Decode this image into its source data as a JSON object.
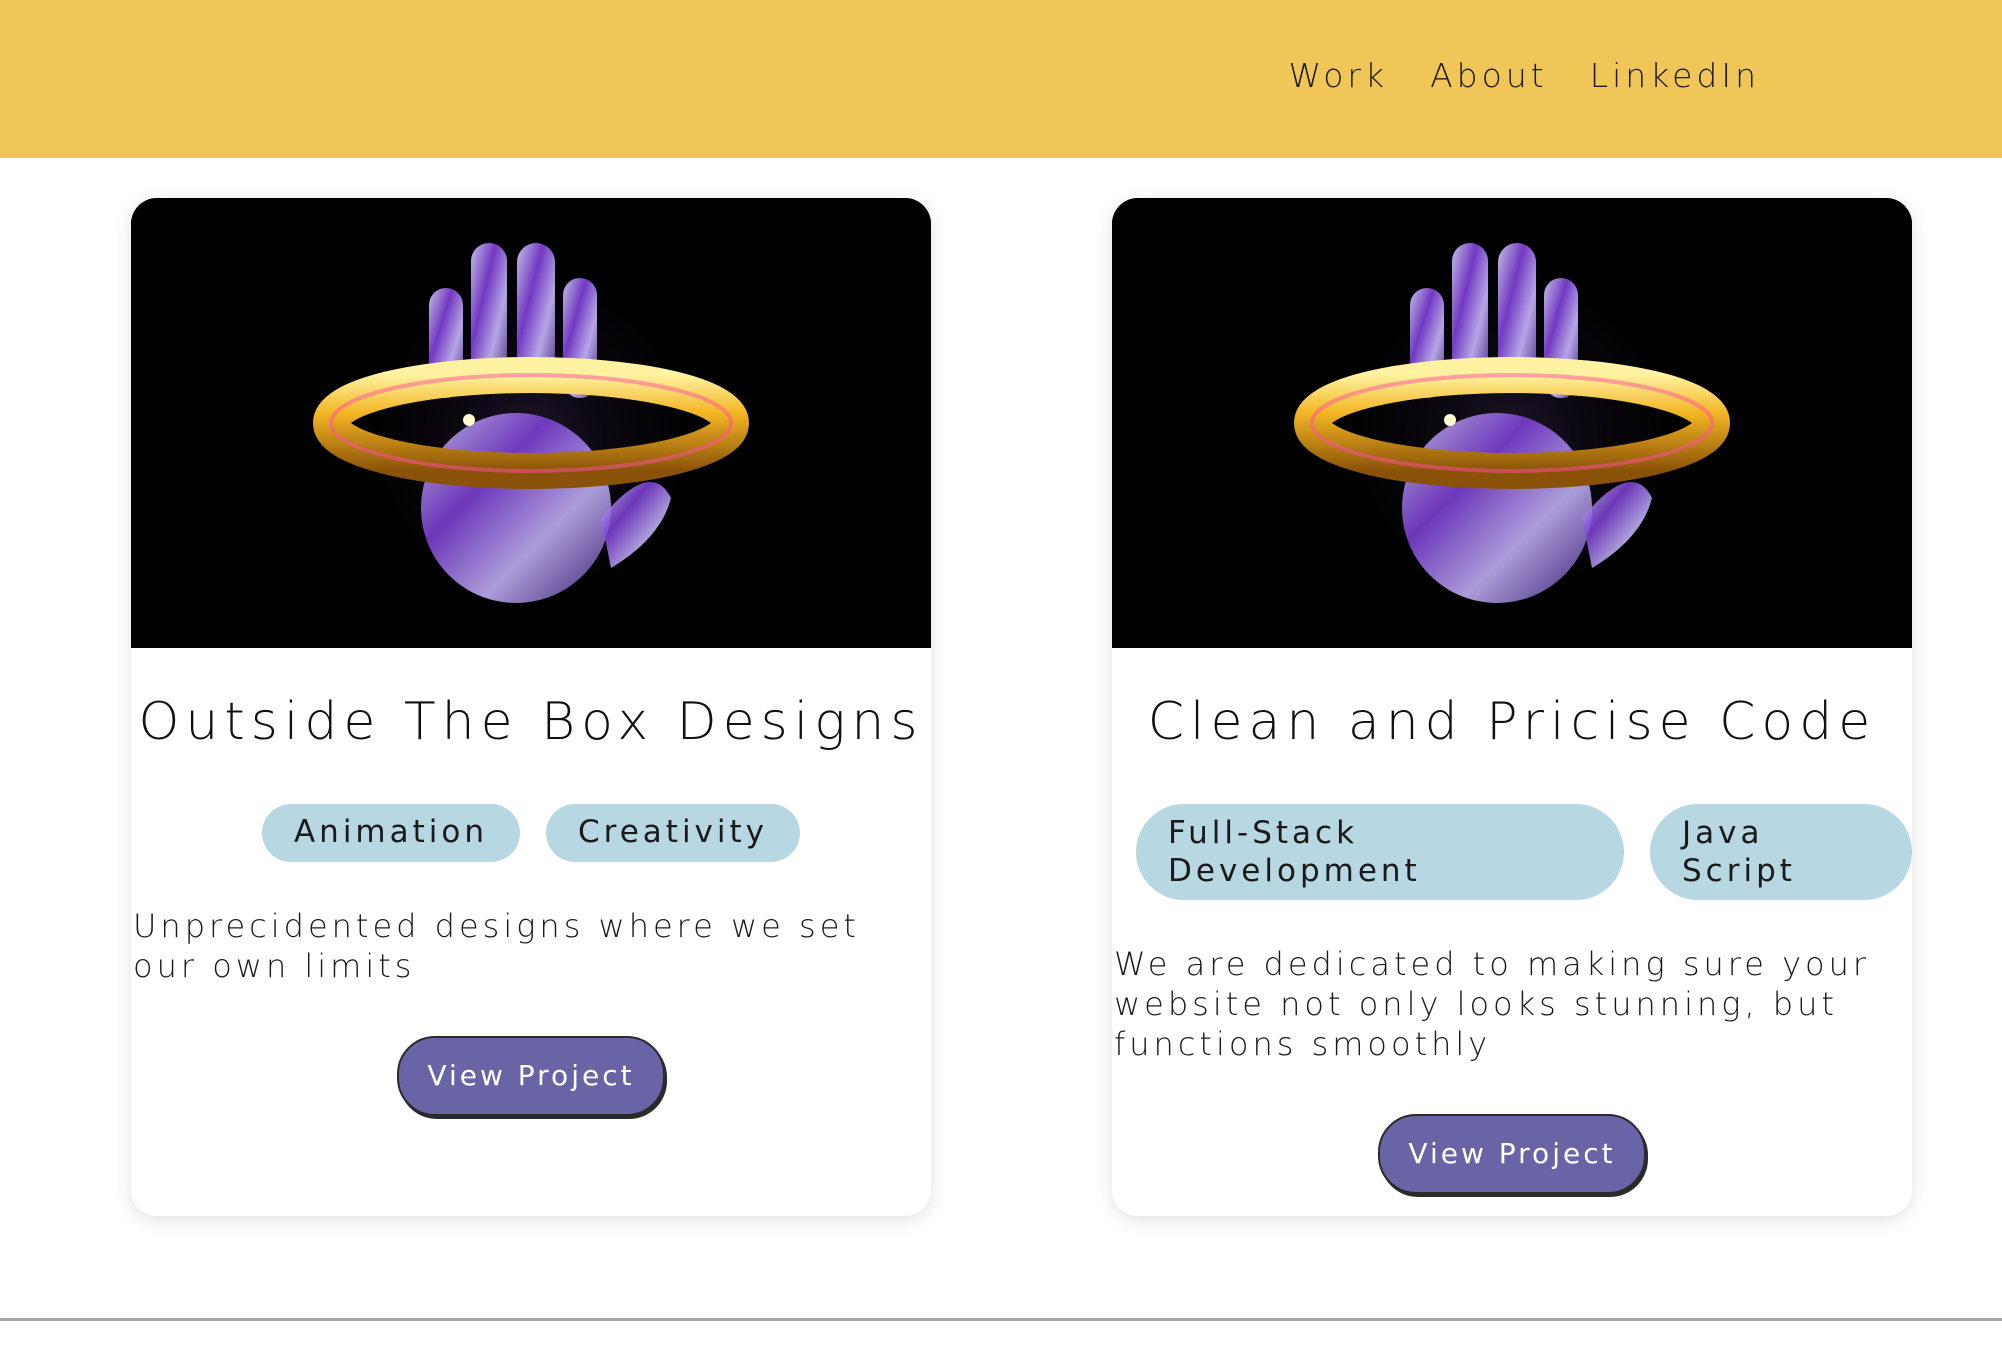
{
  "nav": {
    "items": [
      {
        "label": "Work"
      },
      {
        "label": "About"
      },
      {
        "label": "LinkedIn"
      }
    ]
  },
  "cards": [
    {
      "image_icon": "glass-hand-gold-ring-image",
      "title": "Outside The Box Designs",
      "tags": [
        "Animation",
        "Creativity"
      ],
      "description": "Unprecidented designs where we set our own limits",
      "button_label": "View Project"
    },
    {
      "image_icon": "glass-hand-gold-ring-image",
      "title": "Clean and Pricise Code",
      "tags": [
        "Full-Stack Development",
        "Java Script"
      ],
      "description": "We are dedicated to making sure your website not only looks stunning, but functions smoothly",
      "button_label": "View Project"
    }
  ],
  "colors": {
    "header_bg": "#f1c659",
    "tag_bg": "#b7d7e2",
    "button_bg": "#6864a6"
  }
}
